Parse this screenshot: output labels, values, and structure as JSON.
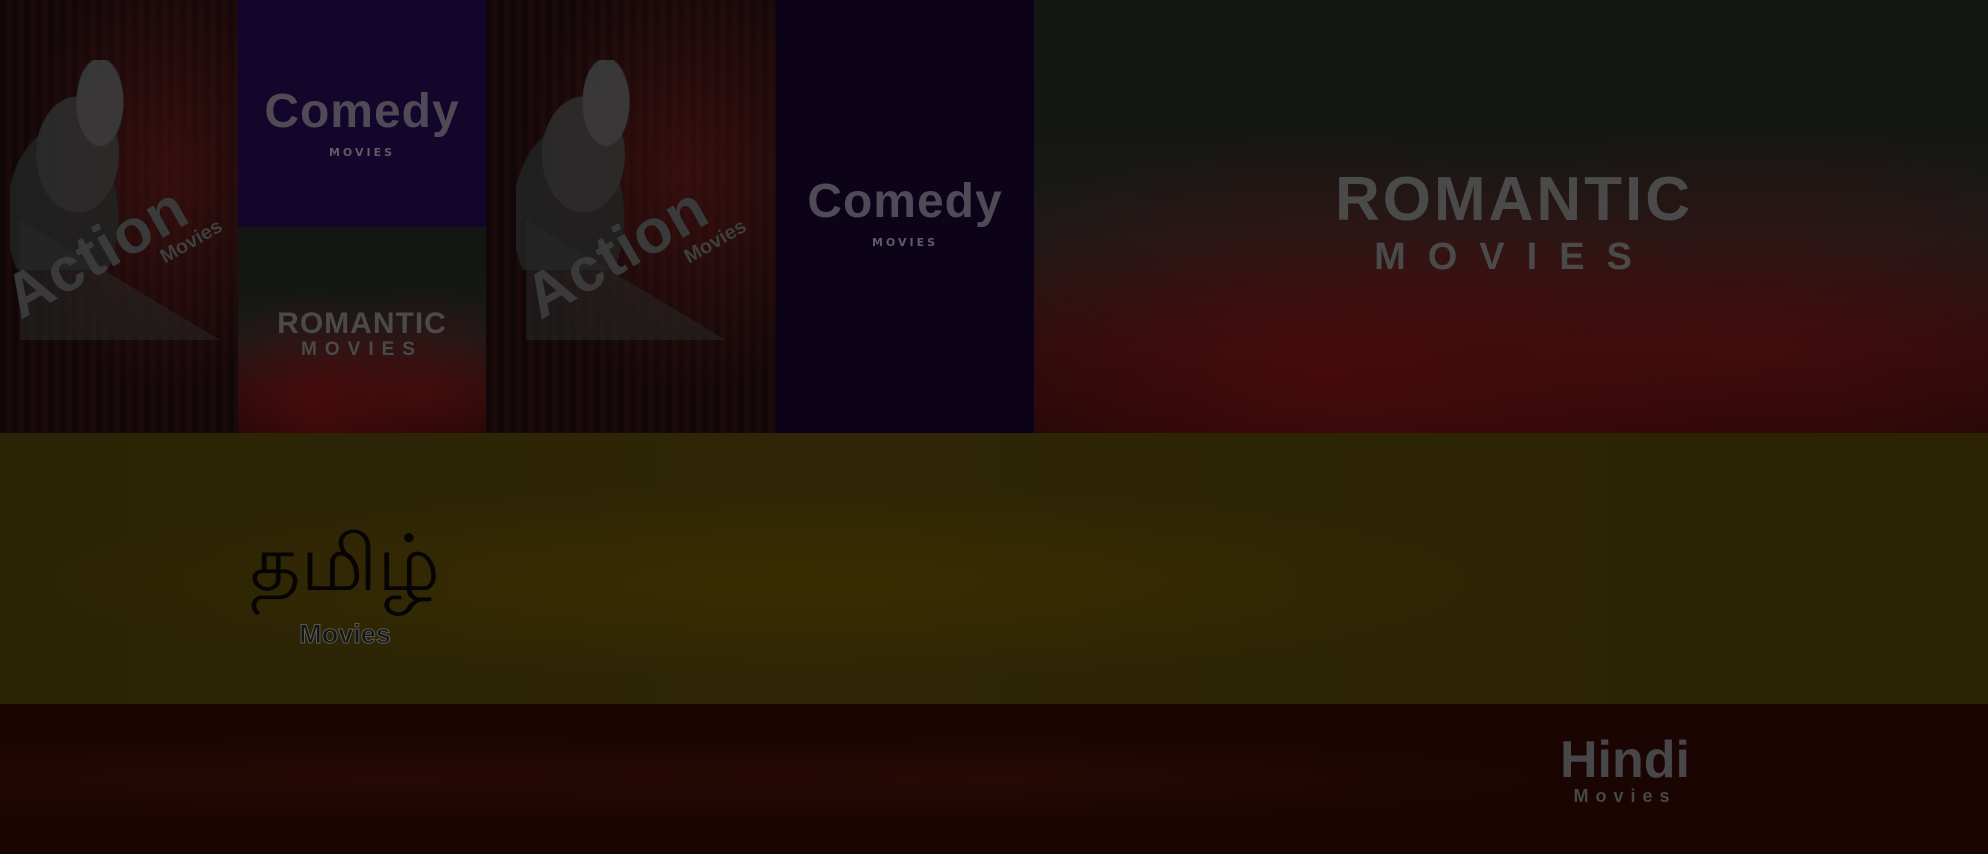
{
  "tiles": {
    "action_1": {
      "title": "Action",
      "subtitle": "Movies"
    },
    "comedy_1": {
      "title": "Comedy",
      "subtitle": "MOVIES"
    },
    "romantic_small": {
      "title": "ROMANTIC",
      "subtitle": "MOVIES"
    },
    "action_2": {
      "title": "Action",
      "subtitle": "Movies"
    },
    "comedy_2": {
      "title": "Comedy",
      "subtitle": "MOVIES"
    },
    "romantic_large": {
      "title": "ROMANTIC",
      "subtitle": "MOVIES"
    }
  },
  "banners": {
    "tamil": {
      "title": "தமிழ்",
      "subtitle": "Movies"
    },
    "hindi": {
      "title": "Hindi",
      "subtitle": "Movies"
    }
  }
}
